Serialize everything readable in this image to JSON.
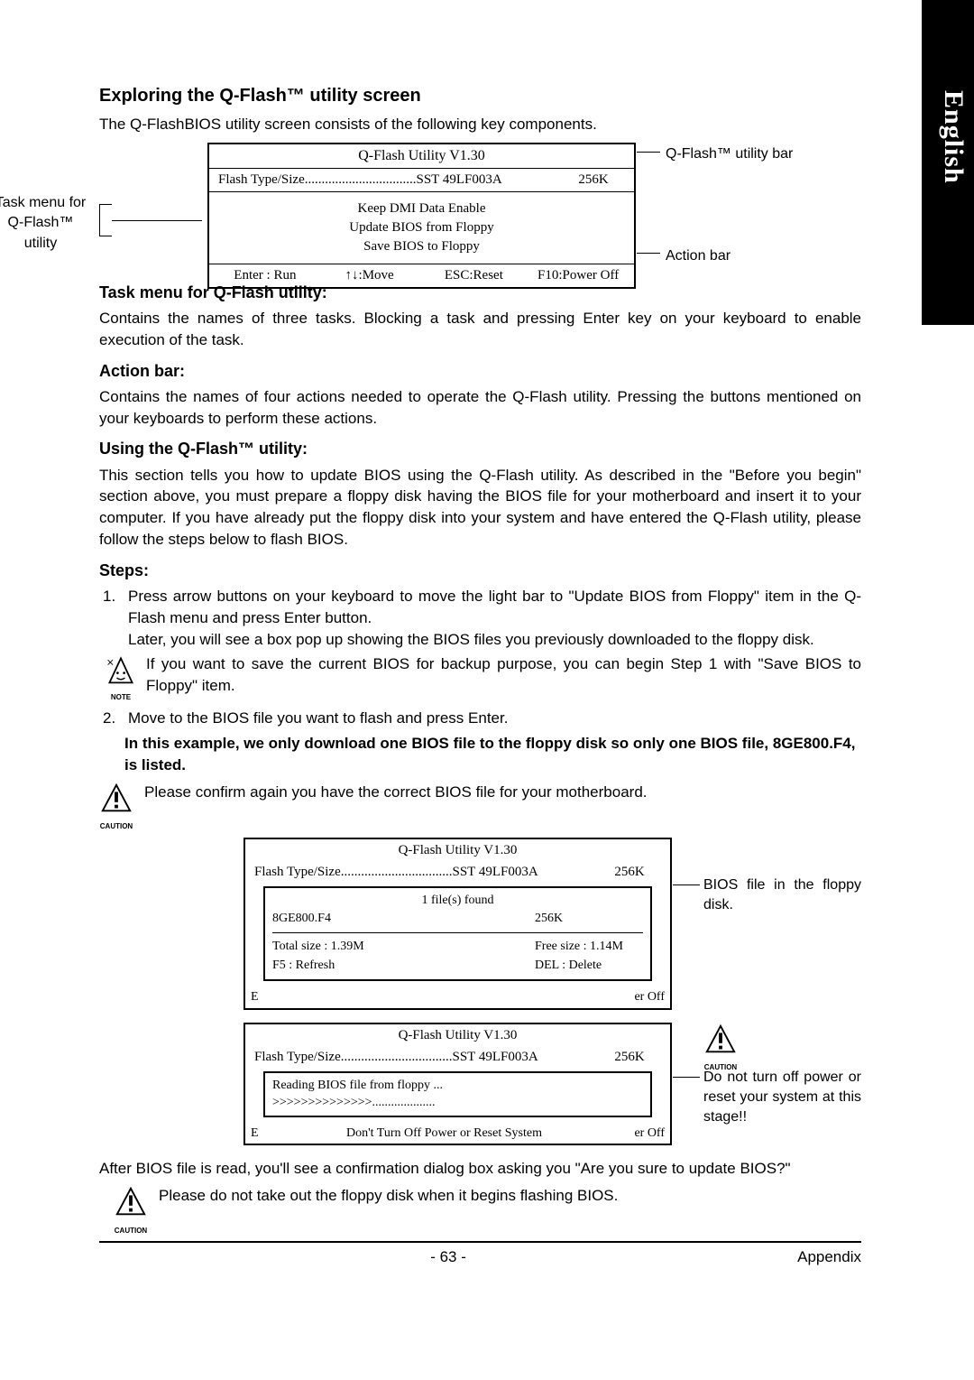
{
  "side_label": "English",
  "h_exploring": "Exploring the Q-Flash™ utility screen",
  "p_exploring": "The Q-FlashBIOS utility screen consists of the following key components.",
  "util_title": "Q-Flash Utility V1.30",
  "flash_type_label": "Flash Type/Size.................................SST 49LF003A",
  "flash_size": "256K",
  "menu_keep": "Keep DMI Data    Enable",
  "menu_update": "Update BIOS from Floppy",
  "menu_save": "Save BIOS to Floppy",
  "action_enter": "Enter : Run",
  "action_move": "↑↓:Move",
  "action_esc": "ESC:Reset",
  "action_f10": "F10:Power Off",
  "label_task_menu": "Task menu for Q-Flash™ utility",
  "label_util_bar": "Q-Flash™ utility bar",
  "label_action_bar": "Action bar",
  "h_task": "Task menu for Q-Flash utility:",
  "p_task": "Contains the names of three tasks. Blocking a task and pressing Enter key on your keyboard to enable execution of the task.",
  "h_action": "Action bar:",
  "p_action": "Contains the names of four actions needed to operate the Q-Flash utility. Pressing the buttons mentioned on your keyboards to perform these actions.",
  "h_using": "Using the Q-Flash™ utility:",
  "p_using": "This section tells you how to update BIOS using the Q-Flash utility. As described in the \"Before you begin\" section above, you must prepare a floppy disk having the BIOS file for your motherboard and insert it to your computer. If you have already put the floppy disk into your system and have entered the Q-Flash utility, please follow the steps below to flash BIOS.",
  "h_steps": "Steps:",
  "step1a": "Press arrow buttons on your keyboard to move the light bar to \"Update BIOS from Floppy\" item in the Q-Flash menu and press Enter button.",
  "step1b": "Later, you will see a box pop up showing the BIOS files you previously downloaded to the floppy disk.",
  "note1": "If you want to save the current BIOS for backup purpose, you can begin Step 1 with \"Save BIOS to Floppy\" item.",
  "step2": "Move to the BIOS file you want to flash and press Enter.",
  "step2_bold": "In this example, we only download one BIOS file to the floppy disk so only one BIOS file, 8GE800.F4, is listed.",
  "caution1": "Please confirm again you have the correct BIOS file for your motherboard.",
  "panel2_files": "1 file(s) found",
  "panel2_bios": "8GE800.F4",
  "panel2_biossize": "256K",
  "panel2_total": "Total size : 1.39M",
  "panel2_free": "Free size : 1.14M",
  "panel2_f5": "F5 : Refresh",
  "panel2_del": "DEL : Delete",
  "panel2_e": "E",
  "panel2_eroff": "er Off",
  "ann_bios_file": "BIOS file in the floppy disk.",
  "panel3_reading": "Reading BIOS file from floppy ...",
  "panel3_prog": ">>>>>>>>>>>>>>....................",
  "panel3_warn": "Don't Turn Off Power or Reset System",
  "ann_caution2": "Do not turn off power or reset your system at this stage!!",
  "p_after": "After BIOS file is read, you'll see a confirmation dialog box asking you \"Are you sure to update BIOS?\"",
  "caution_last": "Please do not take out the floppy disk when it begins flashing BIOS.",
  "page_num": "- 63 -",
  "appendix": "Appendix"
}
